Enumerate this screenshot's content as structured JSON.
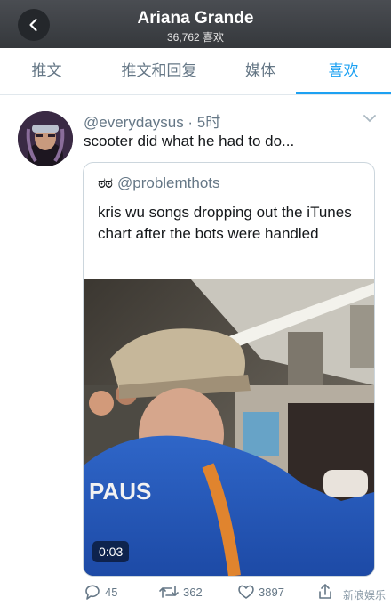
{
  "header": {
    "title": "Ariana Grande",
    "subtitle": "36,762 喜欢"
  },
  "tabs": [
    {
      "label": "推文"
    },
    {
      "label": "推文和回复"
    },
    {
      "label": "媒体"
    },
    {
      "label": "喜欢"
    }
  ],
  "tweet": {
    "handle": "@everydaysus · 5时",
    "text": "scooter did what he had to do...",
    "quote": {
      "handle": "@problemthots",
      "text": "kris wu songs dropping out the iTunes chart after the bots were handled",
      "video_duration": "0:03",
      "video_jacket_text": "PAUS"
    },
    "actions": {
      "replies": "45",
      "retweets": "362",
      "likes": "3897"
    }
  },
  "watermark": "新浪娱乐",
  "colors": {
    "accent": "#1da1f2",
    "header_bg": "#3d4045"
  }
}
